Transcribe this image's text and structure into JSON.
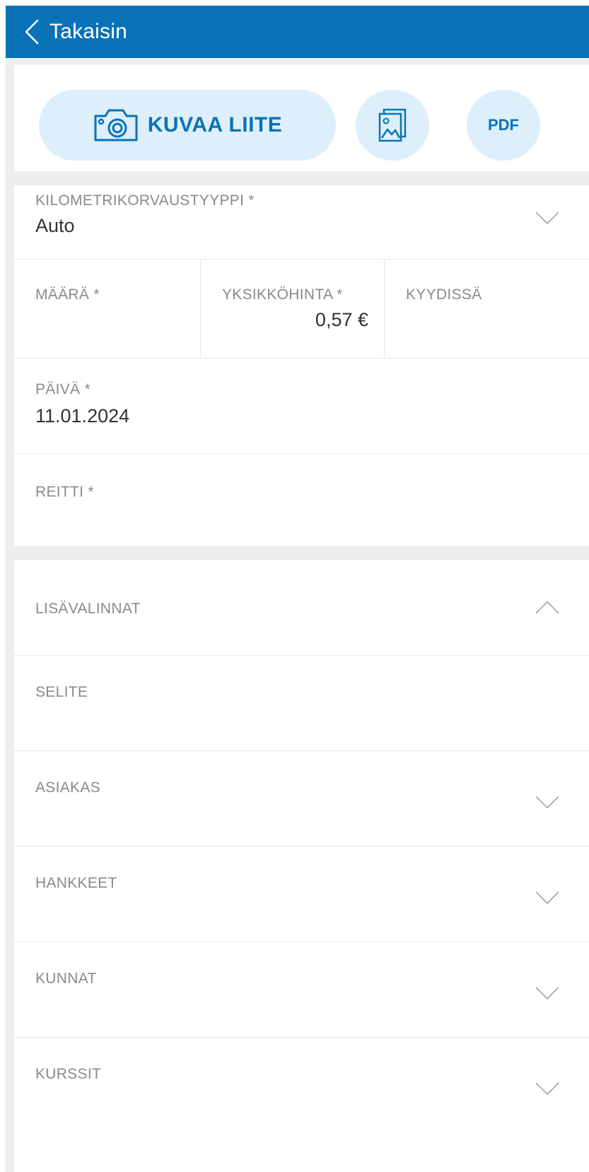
{
  "header": {
    "back_label": "Takaisin"
  },
  "attachments": {
    "photo_label": "KUVAA LIITE",
    "pdf_label": "PDF"
  },
  "form": {
    "type_label": "KILOMETRIKORVAUSTYYPPI *",
    "type_value": "Auto",
    "amount_label": "MÄÄRÄ *",
    "unit_price_label": "YKSIKKÖHINTA *",
    "unit_price_value": "0,57 €",
    "passengers_label": "KYYDISSÄ",
    "date_label": "PÄIVÄ *",
    "date_value": "11.01.2024",
    "route_label": "REITTI *"
  },
  "more": {
    "section_label": "LISÄVALINNAT",
    "description_label": "SELITE",
    "customer_label": "ASIAKAS",
    "projects_label": "HANKKEET",
    "municipalities_label": "KUNNAT",
    "courses_label": "KURSSIT"
  },
  "colors": {
    "header_bg": "#0a72b6",
    "accent": "#0a72b6",
    "button_bg": "#dceffa",
    "page_bg": "#eeeeee"
  },
  "icons": [
    "chevron-left-icon",
    "camera-icon",
    "gallery-icon",
    "chevron-down-icon",
    "chevron-up-icon"
  ]
}
